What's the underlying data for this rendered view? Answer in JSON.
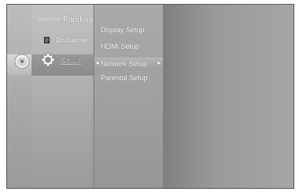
{
  "main_menu": {
    "pandora": {
      "logo_text": "PANDORA",
      "label": "Pandora"
    },
    "disclaimer": {
      "label": "Disclaimer"
    },
    "setup": {
      "label": "Setup"
    }
  },
  "submenu": {
    "items": [
      {
        "label": "Display Setup"
      },
      {
        "label": "HDMI Setup"
      },
      {
        "label": "Network Setup",
        "selected": true
      },
      {
        "label": "Parental Setup"
      }
    ]
  },
  "icons": {
    "disc": "disc-icon",
    "document": "document-icon",
    "gear": "gear-icon",
    "arrow_left": "arrow-left-icon",
    "arrow_right": "arrow-right-icon"
  }
}
